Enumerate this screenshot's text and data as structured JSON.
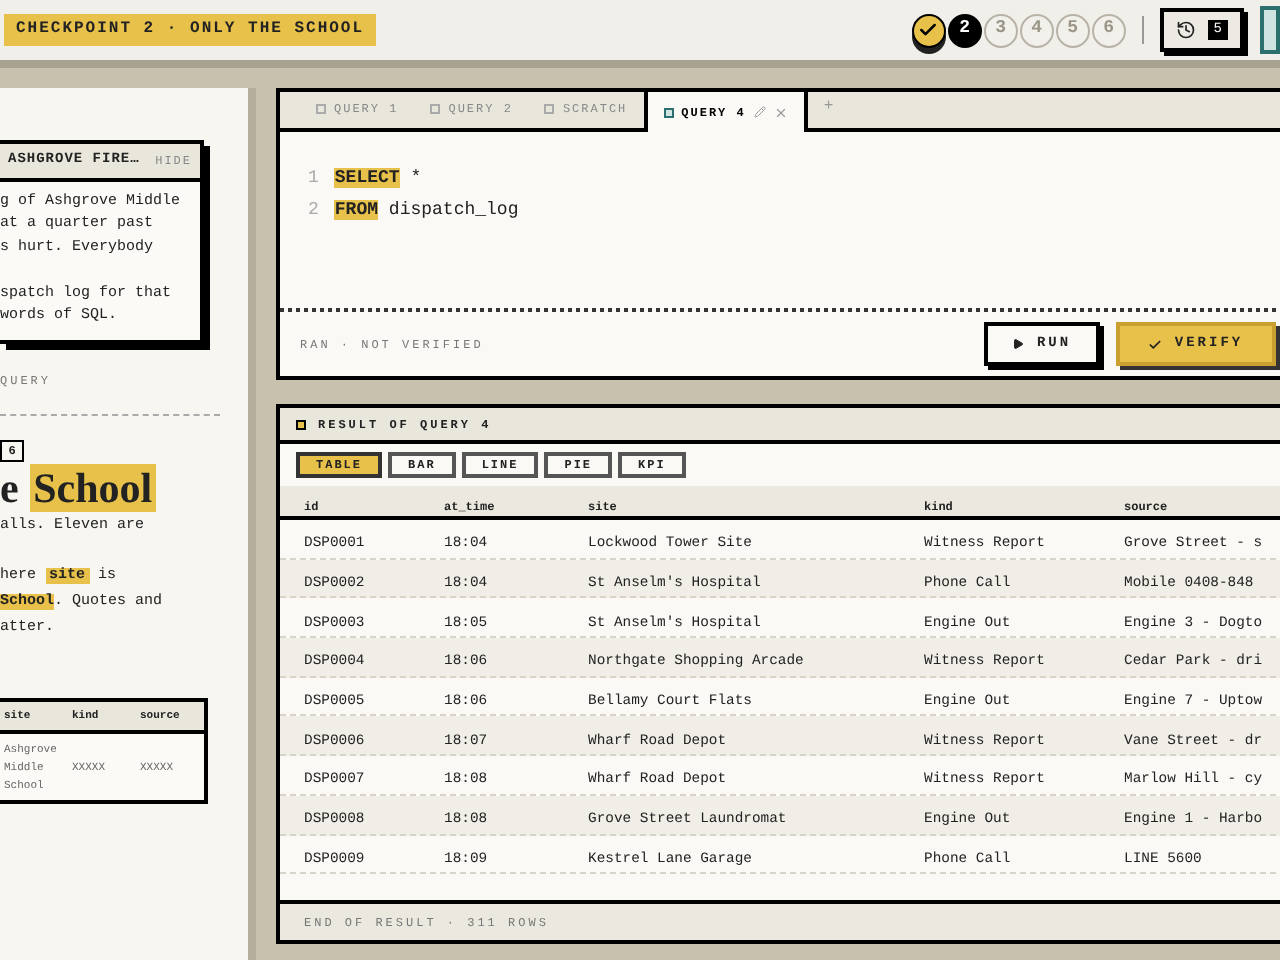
{
  "top_bar": {
    "checkpoint": "CHECKPOINT 2 · ONLY THE SCHOOL",
    "steps": [
      {
        "completed": true,
        "current": false,
        "selected": true
      },
      {
        "label": "2",
        "completed": false,
        "current": true,
        "selected": false
      },
      {
        "label": "3",
        "completed": false,
        "current": false,
        "selected": false
      },
      {
        "label": "4",
        "completed": false,
        "current": false,
        "selected": false
      },
      {
        "label": "5",
        "completed": false,
        "current": false,
        "selected": false
      },
      {
        "label": "6",
        "completed": false,
        "current": false,
        "selected": false
      }
    ],
    "history_count": "5"
  },
  "brief": {
    "card_title": "ASHGROVE FIRE…",
    "hide": "HIDE",
    "card_paragraphs": [
      [
        "g of Ashgrove Middle",
        "at a quarter past",
        "s hurt. Everybody"
      ],
      [
        "spatch log for that",
        "words of SQL."
      ]
    ],
    "query_label": "QUERY",
    "badge": "6",
    "heading_pre": "e ",
    "heading_mark": "School",
    "text_1": "alls. Eleven are",
    "text_2": [
      "here ",
      "site",
      " is"
    ],
    "text_3": [
      "School",
      ". Quotes and"
    ],
    "text_4": "atter.",
    "mini_table": {
      "columns": [
        "site",
        "kind",
        "source"
      ],
      "rows": [
        [
          "Ashgrove Middle School",
          "XXXXX",
          "XXXXX"
        ]
      ]
    }
  },
  "editor": {
    "tabs": [
      {
        "label": "QUERY 1",
        "selected": false
      },
      {
        "label": "QUERY 2",
        "selected": false
      },
      {
        "label": "SCRATCH",
        "selected": false
      },
      {
        "label": "QUERY 4",
        "selected": true
      }
    ],
    "add_tab": "+",
    "lines": [
      {
        "number": "1",
        "keyword": "SELECT",
        "rest": " *"
      },
      {
        "number": "2",
        "keyword": "FROM",
        "rest": " dispatch_log"
      }
    ],
    "status": "RAN · NOT VERIFIED",
    "run": "RUN",
    "verify": "VERIFY"
  },
  "result": {
    "title": "RESULT OF QUERY 4",
    "views": [
      {
        "label": "TABLE",
        "selected": true
      },
      {
        "label": "BAR",
        "selected": false
      },
      {
        "label": "LINE",
        "selected": false
      },
      {
        "label": "PIE",
        "selected": false
      },
      {
        "label": "KPI",
        "selected": false
      }
    ],
    "columns": [
      "id",
      "at_time",
      "site",
      "kind",
      "source"
    ],
    "rows": [
      [
        "DSP0001",
        "18:04",
        "Lockwood Tower Site",
        "Witness Report",
        "Grove Street - s"
      ],
      [
        "DSP0002",
        "18:04",
        "St Anselm's Hospital",
        "Phone Call",
        "Mobile 0408-848"
      ],
      [
        "DSP0003",
        "18:05",
        "St Anselm's Hospital",
        "Engine Out",
        "Engine 3 - Dogto"
      ],
      [
        "DSP0004",
        "18:06",
        "Northgate Shopping Arcade",
        "Witness Report",
        "Cedar Park - dri"
      ],
      [
        "DSP0005",
        "18:06",
        "Bellamy Court Flats",
        "Engine Out",
        "Engine 7 - Uptow"
      ],
      [
        "DSP0006",
        "18:07",
        "Wharf Road Depot",
        "Witness Report",
        "Vane Street - dr"
      ],
      [
        "DSP0007",
        "18:08",
        "Wharf Road Depot",
        "Witness Report",
        "Marlow Hill - cy"
      ],
      [
        "DSP0008",
        "18:08",
        "Grove Street Laundromat",
        "Engine Out",
        "Engine 1 - Harbo"
      ],
      [
        "DSP0009",
        "18:09",
        "Kestrel Lane Garage",
        "Phone Call",
        "LINE 5600"
      ]
    ],
    "footer": "END OF RESULT · 311 ROWS"
  }
}
